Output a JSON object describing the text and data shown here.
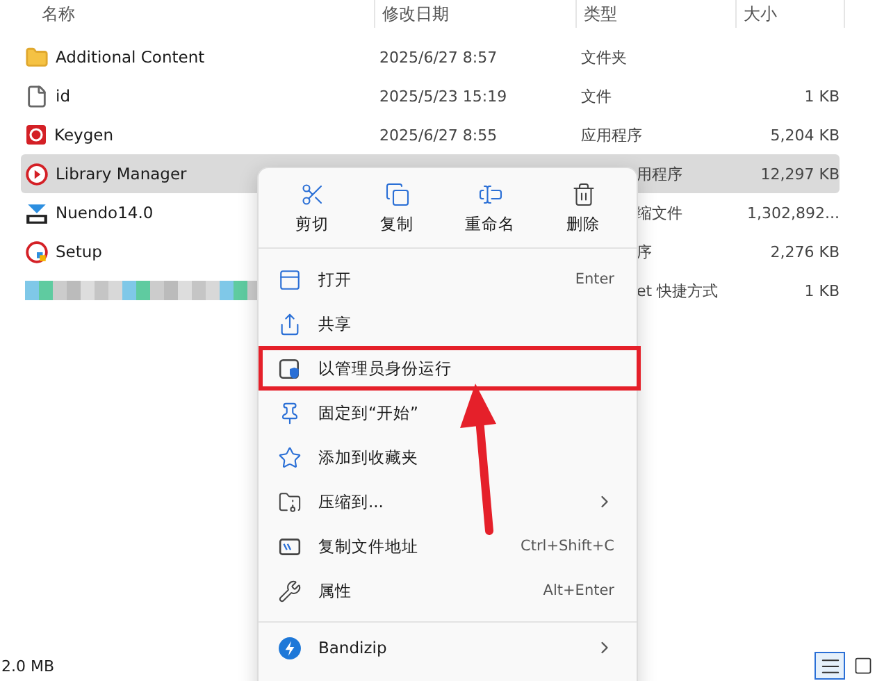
{
  "columns": [
    "名称",
    "修改日期",
    "类型",
    "大小"
  ],
  "files": [
    {
      "kind": "folder",
      "name": "Additional Content",
      "date": "2025/6/27 8:57",
      "type": "文件夹",
      "selected": false,
      "covered": false
    },
    {
      "kind": "file",
      "name": "id",
      "date": "2025/5/23 15:19",
      "type": "文件",
      "size": "1 KB",
      "selected": false,
      "covered": false
    },
    {
      "kind": "keygen",
      "name": "Keygen",
      "date": "2025/6/27 8:55",
      "type": "应用程序",
      "size": "5,204 KB",
      "selected": false,
      "covered": false
    },
    {
      "kind": "app",
      "name": "Library Manager",
      "type": "用程序",
      "size": "12,297 KB",
      "selected": true,
      "covered": true
    },
    {
      "kind": "zip",
      "name": "Nuendo14.0",
      "type": "缩文件",
      "size": "1,302,892...",
      "selected": false,
      "covered": true
    },
    {
      "kind": "setup",
      "name": "Setup",
      "type": "序",
      "size": "2,276 KB",
      "selected": false,
      "covered": true
    },
    {
      "kind": "blurred",
      "type": "et 快捷方式",
      "size": "1 KB",
      "selected": false,
      "covered": true
    }
  ],
  "menu": {
    "actions": [
      {
        "label": "剪切"
      },
      {
        "label": "复制"
      },
      {
        "label": "重命名"
      },
      {
        "label": "删除"
      }
    ],
    "items": [
      {
        "kind": "item",
        "label": "打开",
        "shortcut": "Enter",
        "submenu": false,
        "highlighted": false
      },
      {
        "kind": "item",
        "label": "共享",
        "submenu": false,
        "highlighted": false
      },
      {
        "kind": "item",
        "label": "以管理员身份运行",
        "submenu": false,
        "highlighted": true
      },
      {
        "kind": "item",
        "label": "固定到“开始”",
        "submenu": false,
        "highlighted": false
      },
      {
        "kind": "item",
        "label": "添加到收藏夹",
        "submenu": false,
        "highlighted": false
      },
      {
        "kind": "item",
        "label": "压缩到...",
        "submenu": true,
        "highlighted": false
      },
      {
        "kind": "item",
        "label": "复制文件地址",
        "shortcut": "Ctrl+Shift+C",
        "submenu": false,
        "highlighted": false
      },
      {
        "kind": "item",
        "label": "属性",
        "shortcut": "Alt+Enter",
        "submenu": false,
        "highlighted": false
      },
      {
        "kind": "divider"
      },
      {
        "kind": "item",
        "label": "Bandizip",
        "submenu": true,
        "highlighted": false
      }
    ]
  },
  "status_bar": {
    "size": "2.0 MB",
    "views": [
      {
        "kind": "details",
        "selected": true
      },
      {
        "kind": "tiles",
        "selected": false
      }
    ]
  }
}
